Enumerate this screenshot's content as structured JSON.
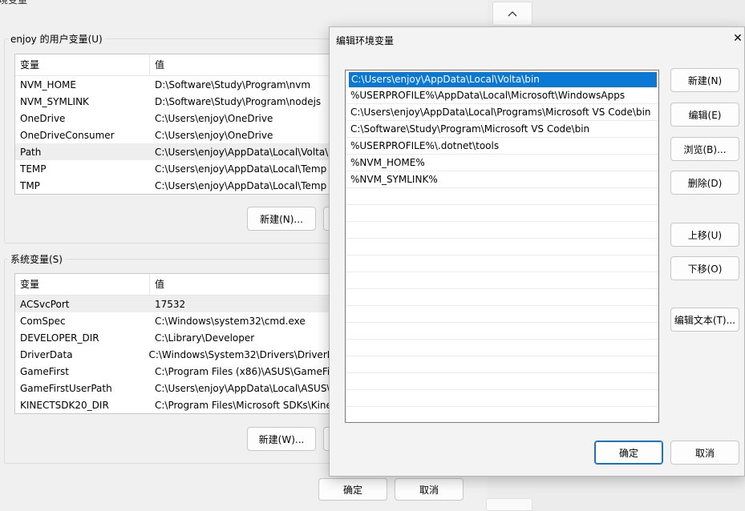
{
  "background_window": {
    "title": "环境变量",
    "user_group_label": "enjoy 的用户变量(U)",
    "system_group_label": "系统变量(S)",
    "columns": [
      "变量",
      "值"
    ],
    "user_vars": [
      {
        "name": "NVM_HOME",
        "value": "D:\\Software\\Study\\Program\\nvm"
      },
      {
        "name": "NVM_SYMLINK",
        "value": "D:\\Software\\Study\\Program\\nodejs"
      },
      {
        "name": "OneDrive",
        "value": "C:\\Users\\enjoy\\OneDrive"
      },
      {
        "name": "OneDriveConsumer",
        "value": "C:\\Users\\enjoy\\OneDrive"
      },
      {
        "name": "Path",
        "value": "C:\\Users\\enjoy\\AppData\\Local\\Volta\\"
      },
      {
        "name": "TEMP",
        "value": "C:\\Users\\enjoy\\AppData\\Local\\Temp"
      },
      {
        "name": "TMP",
        "value": "C:\\Users\\enjoy\\AppData\\Local\\Temp"
      }
    ],
    "system_vars": [
      {
        "name": "ACSvcPort",
        "value": "17532"
      },
      {
        "name": "ComSpec",
        "value": "C:\\Windows\\system32\\cmd.exe"
      },
      {
        "name": "DEVELOPER_DIR",
        "value": "C:\\Library\\Developer"
      },
      {
        "name": "DriverData",
        "value": "C:\\Windows\\System32\\Drivers\\DriverD"
      },
      {
        "name": "GameFirst",
        "value": "C:\\Program Files (x86)\\ASUS\\GameFir"
      },
      {
        "name": "GameFirstUserPath",
        "value": "C:\\Users\\enjoy\\AppData\\Local\\ASUS\\"
      },
      {
        "name": "KINECTSDK20_DIR",
        "value": "C:\\Program Files\\Microsoft SDKs\\Kine"
      }
    ],
    "user_new_button": "新建(N)...",
    "system_new_button": "新建(W)...",
    "ok_button": "确定",
    "cancel_button": "取消"
  },
  "dialog": {
    "title": "编辑环境变量",
    "close_glyph": "✕",
    "entries": [
      "C:\\Users\\enjoy\\AppData\\Local\\Volta\\bin",
      "%USERPROFILE%\\AppData\\Local\\Microsoft\\WindowsApps",
      "C:\\Users\\enjoy\\AppData\\Local\\Programs\\Microsoft VS Code\\bin",
      "C:\\Software\\Study\\Program\\Microsoft VS Code\\bin",
      "%USERPROFILE%\\.dotnet\\tools",
      "%NVM_HOME%",
      "%NVM_SYMLINK%"
    ],
    "selected_index": 0,
    "buttons": {
      "new": "新建(N)",
      "edit": "编辑(E)",
      "browse": "浏览(B)...",
      "delete": "删除(D)",
      "move_up": "上移(U)",
      "move_down": "下移(O)",
      "edit_text": "编辑文本(T)...",
      "ok": "确定",
      "cancel": "取消"
    }
  },
  "colors": {
    "selection": "#0a78d4",
    "primary_border": "#1a72c7"
  }
}
